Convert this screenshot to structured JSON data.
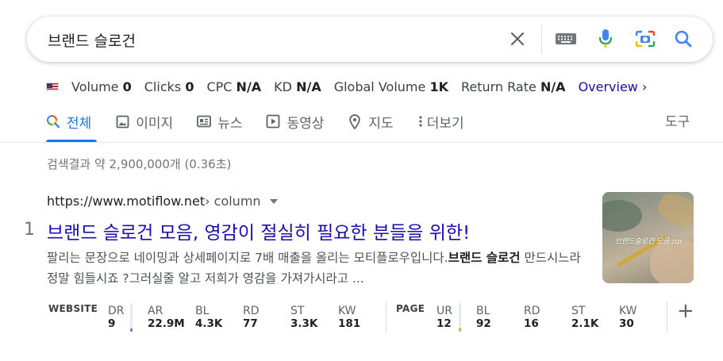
{
  "search": {
    "query": "브랜드 슬로건",
    "icons": [
      "clear-icon",
      "keyboard-icon",
      "microphone-icon",
      "camera-lens-icon",
      "search-icon"
    ]
  },
  "seo_bar": {
    "flag": "us-flag-icon",
    "stats": [
      {
        "label": "Volume",
        "value": "0"
      },
      {
        "label": "Clicks",
        "value": "0"
      },
      {
        "label": "CPC",
        "value": "N/A"
      },
      {
        "label": "KD",
        "value": "N/A"
      },
      {
        "label": "Global Volume",
        "value": "1K"
      },
      {
        "label": "Return Rate",
        "value": "N/A"
      }
    ],
    "overview": "Overview ›"
  },
  "tabs": [
    {
      "label": "전체",
      "icon": "search-icon",
      "active": true
    },
    {
      "label": "이미지",
      "icon": "image-icon"
    },
    {
      "label": "뉴스",
      "icon": "news-icon"
    },
    {
      "label": "동영상",
      "icon": "video-icon"
    },
    {
      "label": "지도",
      "icon": "map-pin-icon"
    },
    {
      "label": "더보기",
      "icon": "more-vert-icon"
    }
  ],
  "tools_label": "도구",
  "result_stats": "검색결과 약 2,900,000개 (0.36초)",
  "result": {
    "rank": "1",
    "url_base": "https://www.motiflow.net",
    "url_path": " › column",
    "title": "브랜드 슬로건 모음, 영감이 절실히 필요한 분들을 위한!",
    "snippet_before": "팔리는 문장으로 네이밍과 상세페이지로 7배 매출을 올리는 모티플로우입니다.",
    "snippet_bold": "브랜드 슬로건",
    "snippet_after": " 만드시느라 정말 힘들시죠 ?그러실줄 알고 저희가 영감을 가져가시라고 ...",
    "thumbnail_text": "브랜드슬로건 모음 zip"
  },
  "metrics": {
    "website_label": "WEBSITE",
    "page_label": "PAGE",
    "website": [
      {
        "label": "DR",
        "value": "9",
        "bar_fraction": 0.1,
        "bar_color": "#6b6bd6"
      },
      {
        "label": "AR",
        "value": "22.9M"
      },
      {
        "label": "BL",
        "value": "4.3K"
      },
      {
        "label": "RD",
        "value": "77"
      },
      {
        "label": "ST",
        "value": "3.3K"
      },
      {
        "label": "KW",
        "value": "181"
      }
    ],
    "page": [
      {
        "label": "UR",
        "value": "12",
        "bar_fraction": 0.14,
        "bar_color": "#9bc94a"
      },
      {
        "label": "BL",
        "value": "92"
      },
      {
        "label": "RD",
        "value": "16"
      },
      {
        "label": "ST",
        "value": "2.1K"
      },
      {
        "label": "KW",
        "value": "30"
      }
    ],
    "plus": "+"
  }
}
